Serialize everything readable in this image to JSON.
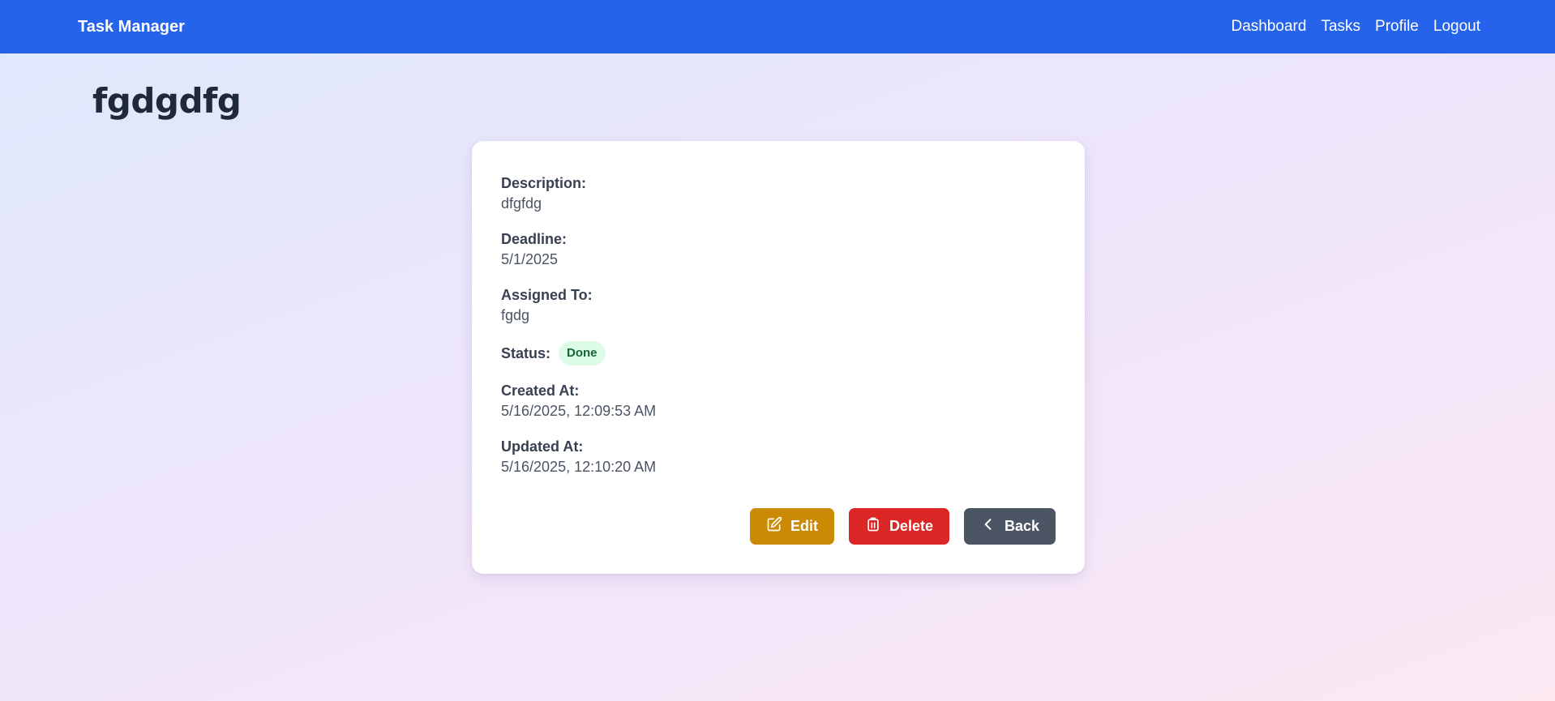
{
  "navbar": {
    "brand": "Task Manager",
    "links": [
      "Dashboard",
      "Tasks",
      "Profile",
      "Logout"
    ]
  },
  "task": {
    "title": "fgdgdfg",
    "description_label": "Description:",
    "description": "dfgfdg",
    "deadline_label": "Deadline:",
    "deadline": "5/1/2025",
    "assigned_label": "Assigned To:",
    "assigned": "fgdg",
    "status_label": "Status:",
    "status": "Done",
    "created_label": "Created At:",
    "created": "5/16/2025, 12:09:53 AM",
    "updated_label": "Updated At:",
    "updated": "5/16/2025, 12:10:20 AM"
  },
  "actions": {
    "edit": "Edit",
    "delete": "Delete",
    "back": "Back"
  },
  "colors": {
    "navbar": "#2563eb",
    "edit": "#ca8a04",
    "delete": "#dc2626",
    "back": "#4b5563",
    "status_badge_bg": "#dcfce7",
    "status_badge_text": "#166534"
  },
  "icons": {
    "edit": "edit-square-icon",
    "delete": "trash-icon",
    "back": "chevron-left-icon"
  }
}
